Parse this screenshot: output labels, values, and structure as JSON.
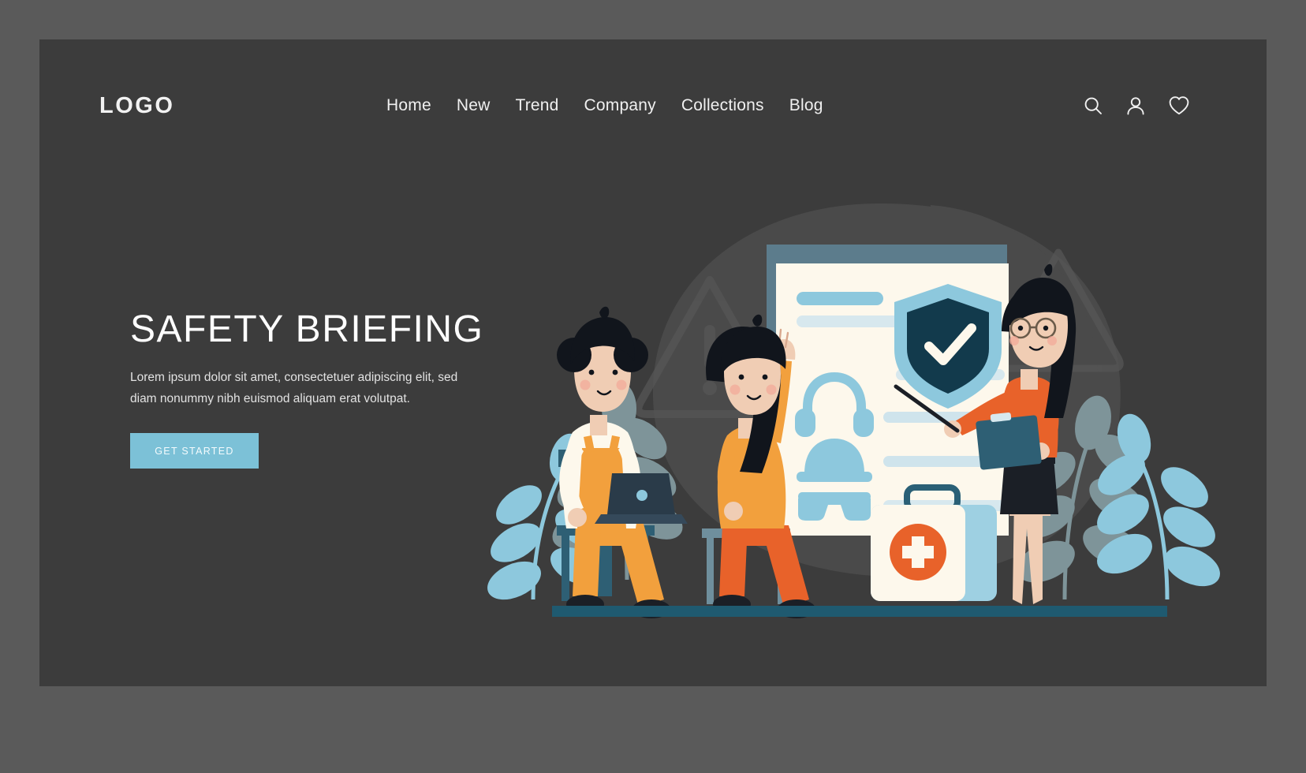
{
  "theme": {
    "outer_frame_color": "#5a5a5a",
    "canvas_color": "#3c3c3c",
    "accent_color": "#7cc1d7",
    "text_color": "#ffffff",
    "orange_accent": "#e8622a",
    "amber_accent": "#f2a03d",
    "deep_navy": "#123a4c",
    "paper_color": "#fdf8ec"
  },
  "header": {
    "logo": "LOGO",
    "nav_items": [
      {
        "label": "Home"
      },
      {
        "label": "New"
      },
      {
        "label": "Trend"
      },
      {
        "label": "Company"
      },
      {
        "label": "Collections"
      },
      {
        "label": "Blog"
      }
    ],
    "icons": [
      {
        "name": "search-icon",
        "label": "Search"
      },
      {
        "name": "user-icon",
        "label": "Account"
      },
      {
        "name": "heart-icon",
        "label": "Favorites"
      }
    ]
  },
  "hero": {
    "title": "SAFETY BRIEFING",
    "description": "Lorem ipsum dolor sit amet, consectetuer adipiscing elit, sed diam nonummy nibh euismod aliquam erat volutpat.",
    "cta_label": "GET STARTED"
  },
  "illustration": {
    "name": "safety-briefing-scene",
    "description": "Flat illustration: instructor with pointer and clipboard presenting a safety poster to two seated women; first aid kit, plants and warning triangles in background.",
    "elements": [
      {
        "name": "safety-poster",
        "items": [
          "headphones-icon",
          "hard-hat-icon",
          "safety-goggles-icon",
          "shield-check-icon",
          "text-bars"
        ]
      },
      {
        "name": "instructor-figure",
        "props": [
          "pointer-stick",
          "clipboard",
          "eyeglasses"
        ]
      },
      {
        "name": "seated-attendee-laptop",
        "props": [
          "laptop",
          "overalls"
        ]
      },
      {
        "name": "seated-attendee-raised-hand",
        "props": [
          "raised-hand"
        ]
      },
      {
        "name": "first-aid-kit",
        "props": [
          "red-cross-emblem",
          "handle"
        ]
      },
      {
        "name": "background-leaf-left"
      },
      {
        "name": "background-leaf-right"
      },
      {
        "name": "warning-triangle-left"
      },
      {
        "name": "warning-triangle-right"
      },
      {
        "name": "background-blob"
      },
      {
        "name": "floor-line"
      }
    ]
  }
}
